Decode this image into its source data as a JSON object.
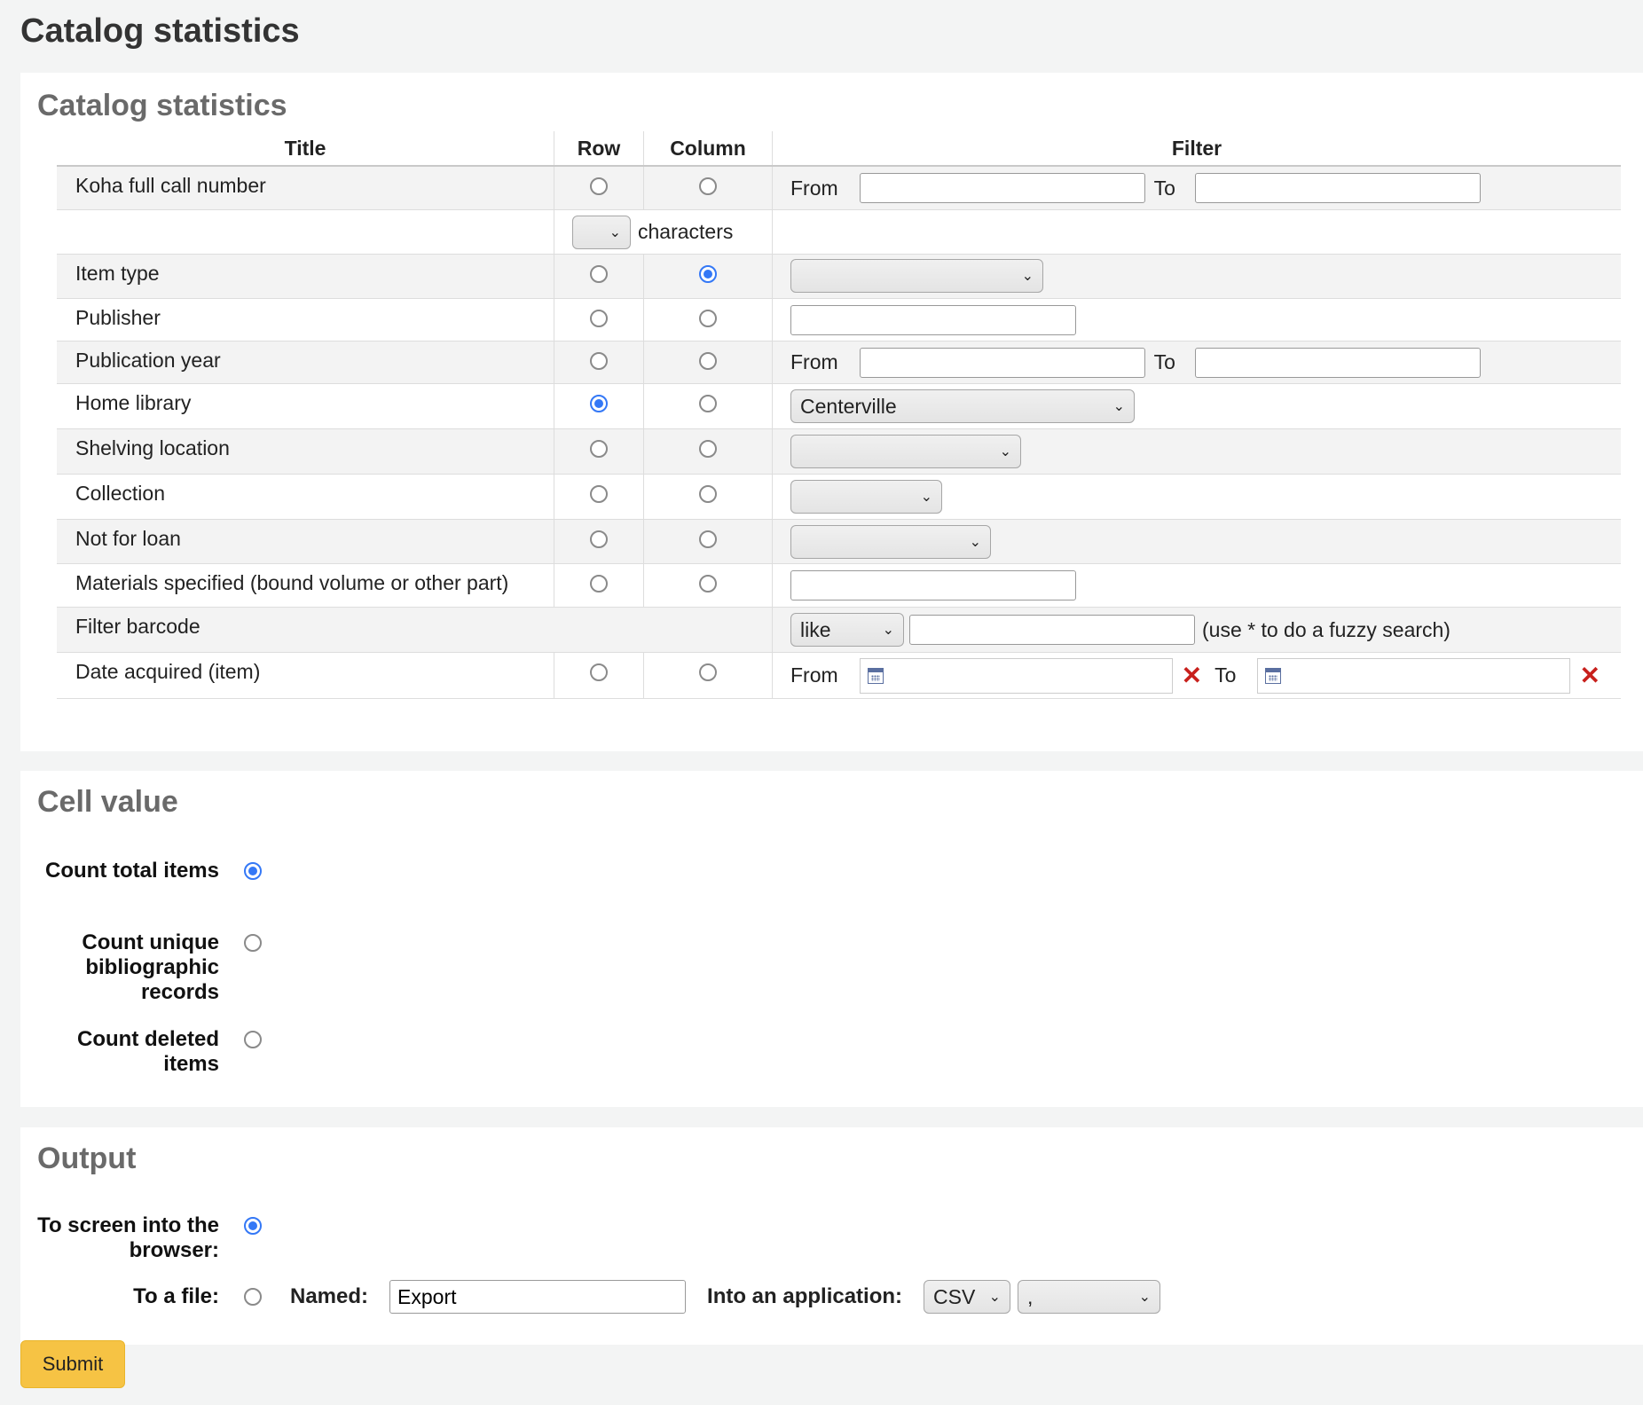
{
  "page_title": "Catalog statistics",
  "section1": {
    "heading": "Catalog statistics",
    "columns": {
      "title": "Title",
      "row": "Row",
      "column": "Column",
      "filter": "Filter"
    },
    "rows": {
      "call_number": {
        "title": "Koha full call number",
        "from": "From",
        "to": "To",
        "chars_label": "characters",
        "chars_value": ""
      },
      "item_type": {
        "title": "Item type",
        "value": ""
      },
      "publisher": {
        "title": "Publisher"
      },
      "pub_year": {
        "title": "Publication year",
        "from": "From",
        "to": "To"
      },
      "home_library": {
        "title": "Home library",
        "value": "Centerville"
      },
      "shelving": {
        "title": "Shelving location",
        "value": ""
      },
      "collection": {
        "title": "Collection",
        "value": ""
      },
      "not_for_loan": {
        "title": "Not for loan",
        "value": ""
      },
      "materials": {
        "title": "Materials specified (bound volume or other part)"
      },
      "barcode": {
        "title": "Filter barcode",
        "op": "like",
        "hint": "(use * to do a fuzzy search)"
      },
      "date_acquired": {
        "title": "Date acquired (item)",
        "from": "From",
        "to": "To"
      }
    }
  },
  "section2": {
    "heading": "Cell value",
    "options": [
      "Count total items",
      "Count unique bibliographic records",
      "Count deleted items"
    ],
    "selected": 0
  },
  "section3": {
    "heading": "Output",
    "to_screen": "To screen into the browser:",
    "to_file": "To a file:",
    "named_label": "Named:",
    "named_value": "Export",
    "app_label": "Into an application:",
    "format": "CSV",
    "separator": ","
  },
  "submit_label": "Submit",
  "colors": {
    "accent": "#3478f6",
    "submit": "#f6c344",
    "remove": "#c8201c"
  }
}
